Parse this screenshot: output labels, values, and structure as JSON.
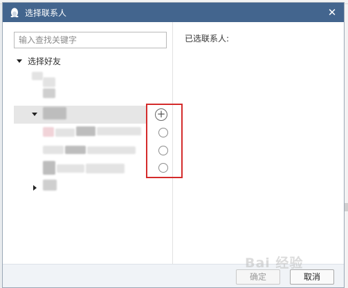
{
  "dialog": {
    "title": "选择联系人",
    "close_glyph": "✕",
    "icon": "qq-penguin-icon"
  },
  "search": {
    "value": "",
    "placeholder": "输入查找关键字"
  },
  "friends_group": {
    "label": "选择好友"
  },
  "contacts": [
    {
      "state": "add",
      "glyph": "+"
    },
    {
      "state": "unselected"
    },
    {
      "state": "unselected"
    },
    {
      "state": "unselected"
    }
  ],
  "selected_panel": {
    "label": "已选联系人:"
  },
  "footer": {
    "ok_label": "确定",
    "ok_enabled": false,
    "cancel_label": "取消"
  },
  "watermark": {
    "text": "Bai 经验"
  },
  "colors": {
    "titlebar": "#43658e",
    "highlight_box": "#d42a2a",
    "footer_bg": "#f0f3f7"
  }
}
